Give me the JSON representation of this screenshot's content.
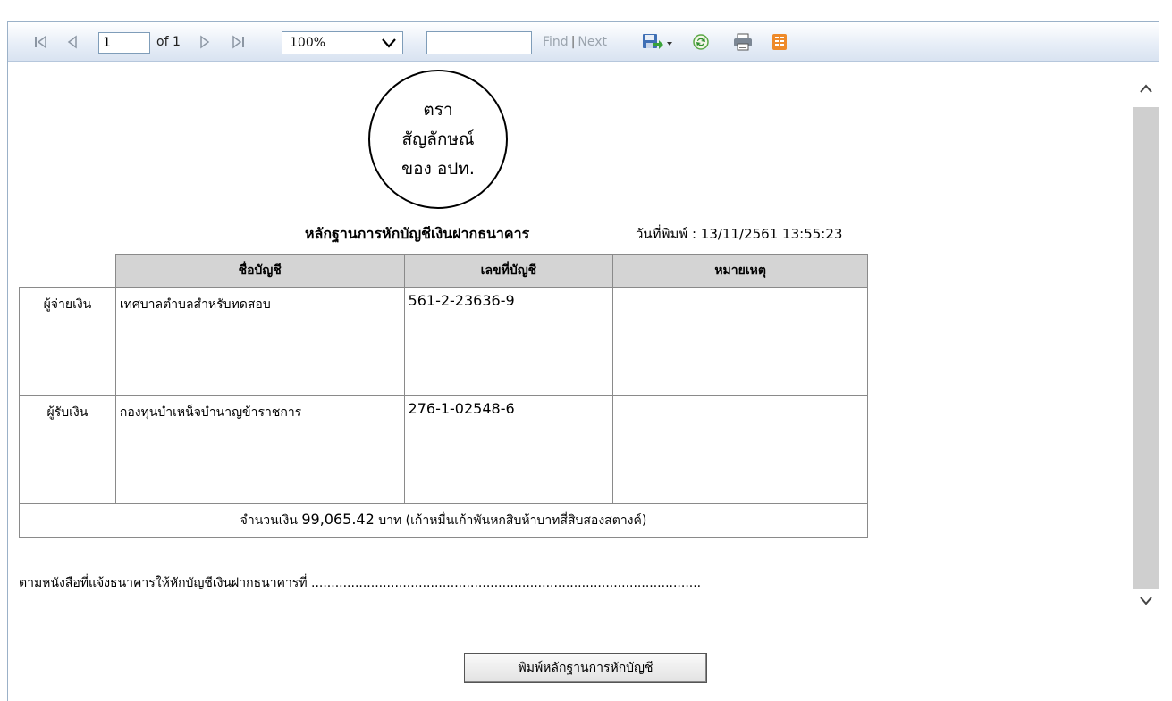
{
  "toolbar": {
    "page_value": "1",
    "of_label": "of 1",
    "zoom_value": "100%",
    "find_value": "",
    "find_label": "Find",
    "find_sep": "|",
    "next_label": "Next",
    "icons": [
      "first-page-icon",
      "prev-page-icon",
      "next-page-icon",
      "last-page-icon",
      "save-icon",
      "refresh-icon",
      "print-icon",
      "layout-icon"
    ]
  },
  "seal": {
    "line1": "ตรา",
    "line2": "สัญลักษณ์",
    "line3": "ของ อปท."
  },
  "document": {
    "title": "หลักฐานการหักบัญชีเงินฝากธนาคาร",
    "print_date": "วันที่พิมพ์ : 13/11/2561 13:55:23"
  },
  "table": {
    "headers": [
      "ชื่อบัญชี",
      "เลขที่บัญชี",
      "หมายเหตุ"
    ],
    "rows": [
      {
        "role": "ผู้จ่ายเงิน",
        "name": "เทศบาลตำบลสำหรับทดสอบ",
        "account": "561-2-23636-9",
        "note": ""
      },
      {
        "role": "ผู้รับเงิน",
        "name": "กองทุนบำเหน็จบำนาญข้าราชการ",
        "account": "276-1-02548-6",
        "note": ""
      }
    ],
    "amount_prefix": "จำนวนเงิน ",
    "amount_value": "99,065.42",
    "amount_suffix": " บาท (เก้าหมื่นเก้าพันหกสิบห้าบาทสี่สิบสองสตางค์)"
  },
  "reference_line": "ตามหนังสือที่แจ้งธนาคารให้หักบัญชีเงินฝากธนาคารที่ ..................................................................................................",
  "print_button_label": "พิมพ์หลักฐานการหักบัญชี",
  "colors": {
    "toolbar_gradient_end": "#d9e3f1",
    "header_bg": "#d4d4d4",
    "scroll_track": "#cfcfcf",
    "frame_border": "#9bb1c8"
  }
}
